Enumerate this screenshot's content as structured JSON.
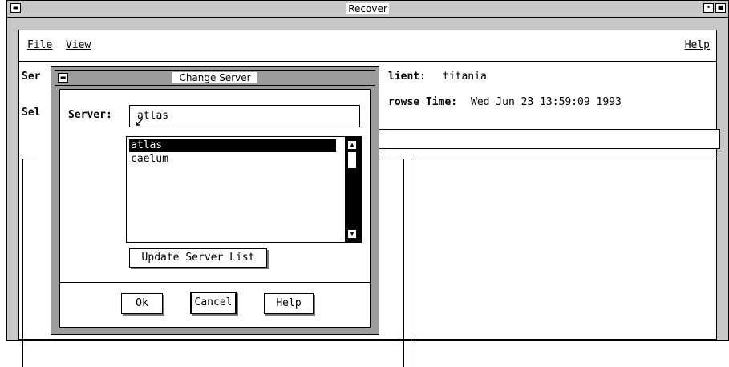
{
  "main_window": {
    "title": "Recover",
    "menus": [
      "File",
      "View",
      "Help"
    ],
    "server_label_fragment": "Ser",
    "select_label_fragment": "Sel",
    "client_label": "lient:",
    "client_value": "titania",
    "browse_label": "rowse Time:",
    "browse_value": "Wed Jun 23 13:59:09 1993"
  },
  "dialog": {
    "title": "Change Server",
    "server_label": "Server:",
    "server_value": "atlas",
    "servers": [
      "atlas",
      "caelum"
    ],
    "selected_server": "atlas",
    "update_button": "Update Server List",
    "ok_button": "Ok",
    "cancel_button": "Cancel",
    "help_button": "Help"
  },
  "icons": {
    "window_menu": "window-menu-icon",
    "minimize": "minimize-icon",
    "maximize": "maximize-icon",
    "scroll_up": "scroll-up-arrow-icon",
    "scroll_down": "scroll-down-arrow-icon",
    "mouse_cursor": "mouse-pointer-icon"
  },
  "colors": {
    "selection_bg": "#000000",
    "selection_fg": "#ffffff"
  }
}
